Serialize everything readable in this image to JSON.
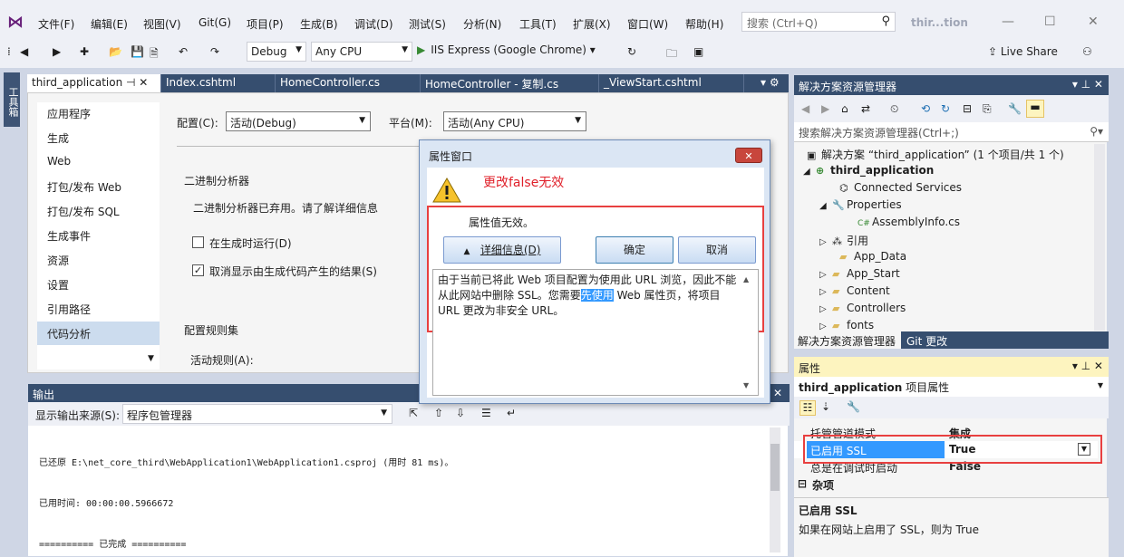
{
  "menubar": {
    "items": [
      "文件(F)",
      "编辑(E)",
      "视图(V)",
      "Git(G)",
      "项目(P)",
      "生成(B)",
      "调试(D)",
      "测试(S)",
      "分析(N)",
      "工具(T)",
      "扩展(X)",
      "窗口(W)",
      "帮助(H)"
    ],
    "search_placeholder": "搜索 (Ctrl+Q)",
    "window_title": "thir...tion"
  },
  "toolbar": {
    "config": "Debug",
    "platform": "Any CPU",
    "run_label": "IIS Express (Google Chrome)",
    "live_share": "Live Share"
  },
  "toolbox_label": "工具箱",
  "doc_tabs": [
    "third_application",
    "Index.cshtml",
    "HomeController.cs",
    "HomeController - 复制.cs",
    "_ViewStart.cshtml"
  ],
  "prop_page": {
    "nav": [
      "应用程序",
      "生成",
      "Web",
      "打包/发布 Web",
      "打包/发布 SQL",
      "生成事件",
      "资源",
      "设置",
      "引用路径",
      "代码分析"
    ],
    "config_label": "配置(C):",
    "config_value": "活动(Debug)",
    "platform_label": "平台(M):",
    "platform_value": "活动(Any CPU)",
    "binary_analyzer_heading": "二进制分析器",
    "binary_analyzer_text": "二进制分析器已弃用。请了解详细信息",
    "run_on_build": "在生成时运行(D)",
    "suppress_results": "取消显示由生成代码产生的结果(S)",
    "ruleset_heading": "配置规则集",
    "active_rules": "活动规则(A):"
  },
  "output": {
    "title": "输出",
    "source_label": "显示输出来源(S):",
    "source_value": "程序包管理器",
    "lines": [
      "已还原 E:\\net_core_third\\WebApplication1\\WebApplication1.csproj (用时 81 ms)。",
      "已用时间: 00:00:00.5966672",
      "========== 已完成 =========="
    ]
  },
  "dialog": {
    "title": "属性窗口",
    "close": "✕",
    "annotation": "更改false无效",
    "message": "属性值无效。",
    "details_button": "详细信息(D)",
    "ok_button": "确定",
    "cancel_button": "取消",
    "detail_before": "由于当前已将此 Web 项目配置为使用此 URL 浏览，因此不能从此网站中删除 SSL。您需要",
    "detail_highlight": "先使用",
    "detail_after": " Web 属性页，将项目 URL 更改为非安全 URL。"
  },
  "solution_explorer": {
    "title": "解决方案资源管理器",
    "search_placeholder": "搜索解决方案资源管理器(Ctrl+;)",
    "solution": "解决方案 “third_application” (1 个项目/共 1 个)",
    "project": "third_application",
    "items": [
      "Connected Services",
      "Properties",
      "AssemblyInfo.cs",
      "引用",
      "App_Data",
      "App_Start",
      "Content",
      "Controllers",
      "fonts"
    ],
    "tab_explorer": "解决方案资源管理器",
    "tab_git": "Git 更改"
  },
  "properties": {
    "title": "属性",
    "object_name": "third_application",
    "object_type": "项目属性",
    "rows": [
      {
        "name": "托管管道模式",
        "value": "集成"
      },
      {
        "name": "已启用 SSL",
        "value": "True"
      },
      {
        "name": "总是在调试时启动",
        "value": "False"
      }
    ],
    "category_misc": "杂项",
    "desc_title": "已启用 SSL",
    "desc_text": "如果在网站上启用了 SSL，则为 True"
  },
  "colors": {
    "accent": "#364e6f",
    "warning_red": "#e84040",
    "selection": "#3399ff"
  }
}
